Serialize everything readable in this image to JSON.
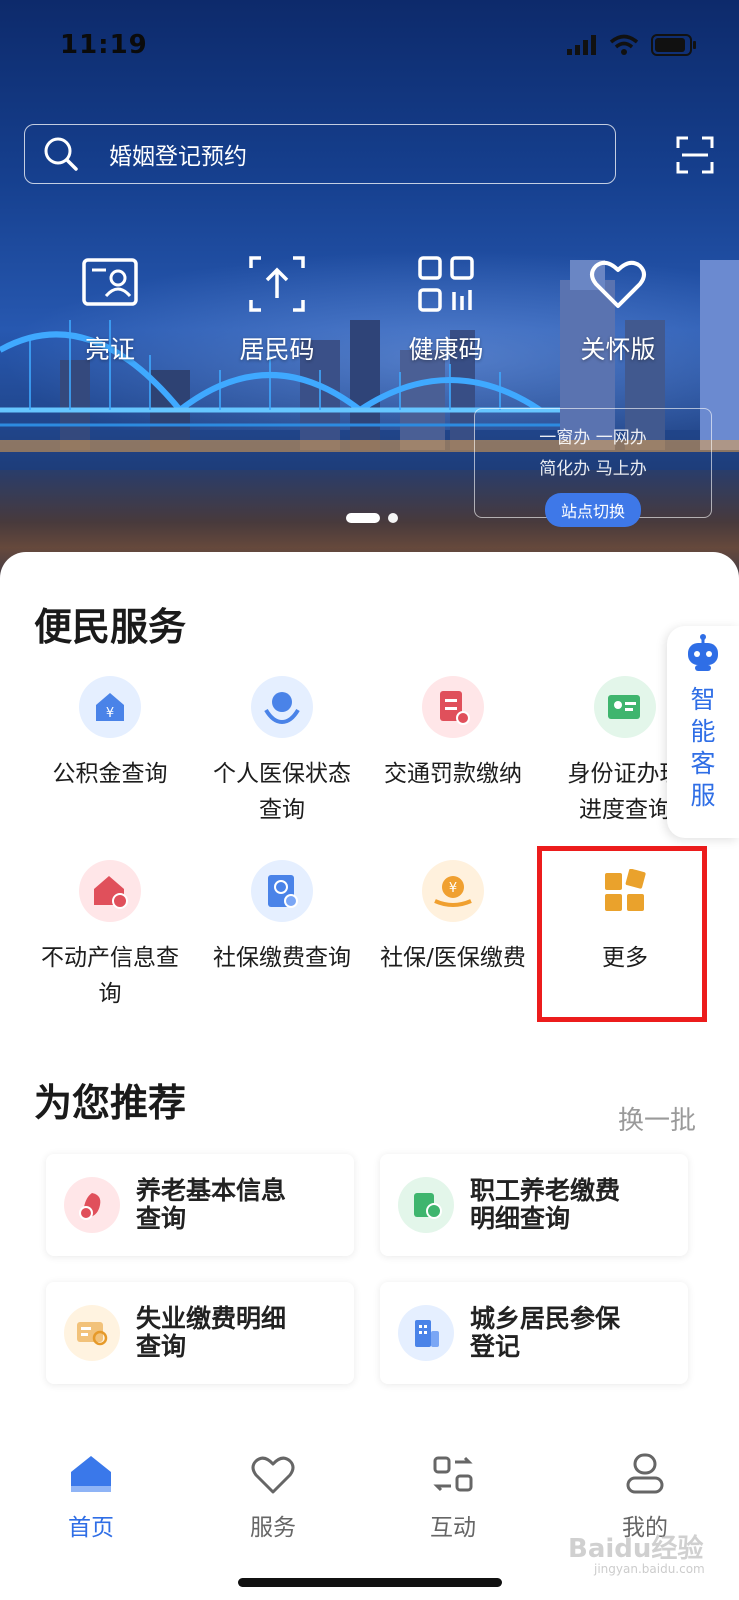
{
  "status_bar": {
    "time": "11:19"
  },
  "search": {
    "text": "婚姻登记预约"
  },
  "quick_actions": [
    {
      "label": "亮证",
      "icon": "id-card-icon"
    },
    {
      "label": "居民码",
      "icon": "qr-upload-icon"
    },
    {
      "label": "健康码",
      "icon": "health-code-icon"
    },
    {
      "label": "关怀版",
      "icon": "heart-icon"
    }
  ],
  "banner": {
    "line1": "一窗办  一网办",
    "line2": "简化办  马上办",
    "switch_label": "站点切换"
  },
  "convenience": {
    "title": "便民服务",
    "items": [
      {
        "label": "公积金查询",
        "icon": "housing-fund-icon",
        "color": "#4a83e8"
      },
      {
        "label": "个人医保状态查询",
        "icon": "medical-insurance-icon",
        "color": "#4a83e8"
      },
      {
        "label": "交通罚款缴纳",
        "icon": "traffic-fine-icon",
        "color": "#e0505b"
      },
      {
        "label": "身份证办理进度查询",
        "icon": "id-progress-icon",
        "color": "#3fb56e"
      },
      {
        "label": "不动产信息查询",
        "icon": "real-estate-icon",
        "color": "#e0505b"
      },
      {
        "label": "社保缴费查询",
        "icon": "social-security-icon",
        "color": "#4a83e8"
      },
      {
        "label": "社保/医保缴费",
        "icon": "payment-icon",
        "color": "#f0a030"
      },
      {
        "label": "更多",
        "icon": "more-grid-icon",
        "color": "#eaa22c"
      }
    ]
  },
  "customer_service": {
    "label": "智能客服"
  },
  "recommend": {
    "title": "为您推荐",
    "switch_label": "换一批",
    "items": [
      {
        "label": "养老基本信息查询",
        "icon": "pension-info-icon"
      },
      {
        "label": "职工养老缴费明细查询",
        "icon": "pension-payment-icon"
      },
      {
        "label": "失业缴费明细查询",
        "icon": "unemployment-icon"
      },
      {
        "label": "城乡居民参保登记",
        "icon": "resident-insurance-icon"
      }
    ]
  },
  "tabbar": {
    "items": [
      {
        "label": "首页",
        "icon": "home-icon",
        "active": true
      },
      {
        "label": "服务",
        "icon": "heart-outline-icon",
        "active": false
      },
      {
        "label": "互动",
        "icon": "interact-icon",
        "active": false
      },
      {
        "label": "我的",
        "icon": "user-icon",
        "active": false
      }
    ]
  },
  "watermark": {
    "text": "Baidu经验",
    "sub": "jingyan.baidu.com"
  },
  "colors": {
    "accent": "#2f6ee6",
    "highlight": "#ec1c1c"
  }
}
